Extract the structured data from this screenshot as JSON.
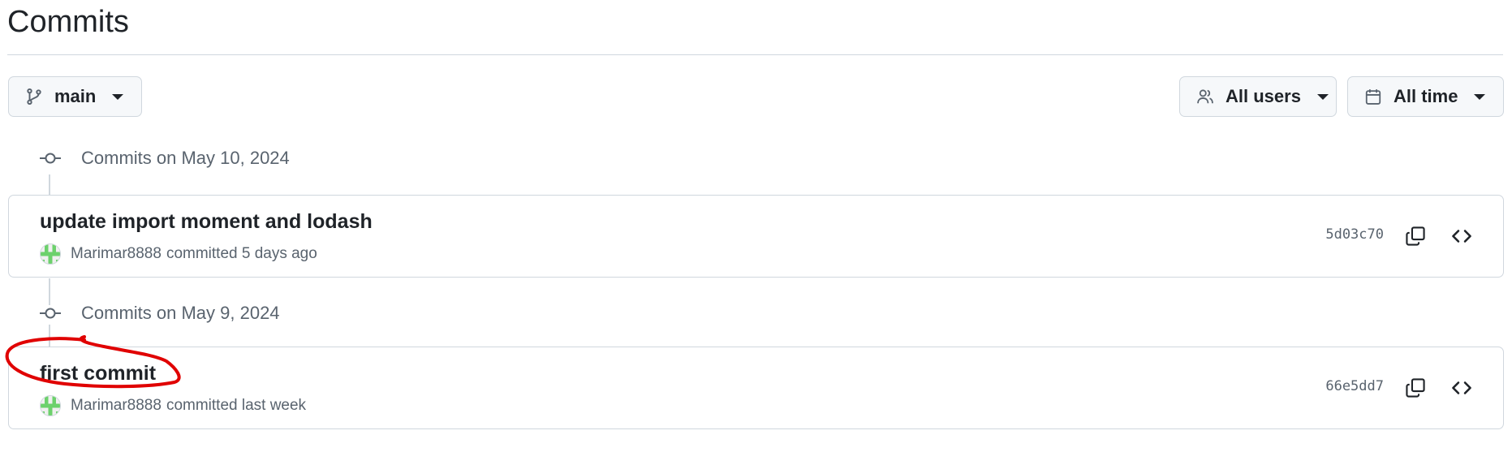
{
  "page": {
    "title": "Commits"
  },
  "filters": {
    "branch": {
      "label": "main",
      "icon": "git-branch-icon"
    },
    "users": {
      "label": "All users",
      "icon": "people-icon"
    },
    "time": {
      "label": "All time",
      "icon": "calendar-icon"
    }
  },
  "groups": [
    {
      "header": "Commits on May 10, 2024",
      "commit": {
        "title": "update import moment and lodash",
        "author": "Marimar8888",
        "action": "committed 5 days ago",
        "sha": "5d03c70"
      }
    },
    {
      "header": "Commits on May 9, 2024",
      "commit": {
        "title": "first commit",
        "author": "Marimar8888",
        "action": "committed last week",
        "sha": "66e5dd7"
      }
    }
  ],
  "colors": {
    "annotation": "#e00000",
    "border": "#d0d7de",
    "muted": "#59636e"
  }
}
